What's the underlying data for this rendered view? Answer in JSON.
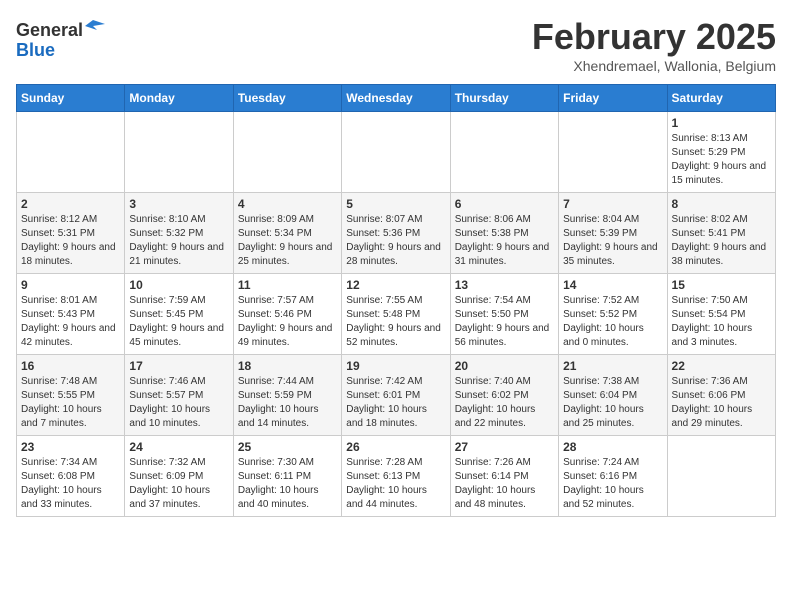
{
  "header": {
    "logo_line1": "General",
    "logo_line2": "Blue",
    "month_year": "February 2025",
    "location": "Xhendremael, Wallonia, Belgium"
  },
  "weekdays": [
    "Sunday",
    "Monday",
    "Tuesday",
    "Wednesday",
    "Thursday",
    "Friday",
    "Saturday"
  ],
  "weeks": [
    [
      {
        "day": "",
        "info": ""
      },
      {
        "day": "",
        "info": ""
      },
      {
        "day": "",
        "info": ""
      },
      {
        "day": "",
        "info": ""
      },
      {
        "day": "",
        "info": ""
      },
      {
        "day": "",
        "info": ""
      },
      {
        "day": "1",
        "info": "Sunrise: 8:13 AM\nSunset: 5:29 PM\nDaylight: 9 hours and 15 minutes."
      }
    ],
    [
      {
        "day": "2",
        "info": "Sunrise: 8:12 AM\nSunset: 5:31 PM\nDaylight: 9 hours and 18 minutes."
      },
      {
        "day": "3",
        "info": "Sunrise: 8:10 AM\nSunset: 5:32 PM\nDaylight: 9 hours and 21 minutes."
      },
      {
        "day": "4",
        "info": "Sunrise: 8:09 AM\nSunset: 5:34 PM\nDaylight: 9 hours and 25 minutes."
      },
      {
        "day": "5",
        "info": "Sunrise: 8:07 AM\nSunset: 5:36 PM\nDaylight: 9 hours and 28 minutes."
      },
      {
        "day": "6",
        "info": "Sunrise: 8:06 AM\nSunset: 5:38 PM\nDaylight: 9 hours and 31 minutes."
      },
      {
        "day": "7",
        "info": "Sunrise: 8:04 AM\nSunset: 5:39 PM\nDaylight: 9 hours and 35 minutes."
      },
      {
        "day": "8",
        "info": "Sunrise: 8:02 AM\nSunset: 5:41 PM\nDaylight: 9 hours and 38 minutes."
      }
    ],
    [
      {
        "day": "9",
        "info": "Sunrise: 8:01 AM\nSunset: 5:43 PM\nDaylight: 9 hours and 42 minutes."
      },
      {
        "day": "10",
        "info": "Sunrise: 7:59 AM\nSunset: 5:45 PM\nDaylight: 9 hours and 45 minutes."
      },
      {
        "day": "11",
        "info": "Sunrise: 7:57 AM\nSunset: 5:46 PM\nDaylight: 9 hours and 49 minutes."
      },
      {
        "day": "12",
        "info": "Sunrise: 7:55 AM\nSunset: 5:48 PM\nDaylight: 9 hours and 52 minutes."
      },
      {
        "day": "13",
        "info": "Sunrise: 7:54 AM\nSunset: 5:50 PM\nDaylight: 9 hours and 56 minutes."
      },
      {
        "day": "14",
        "info": "Sunrise: 7:52 AM\nSunset: 5:52 PM\nDaylight: 10 hours and 0 minutes."
      },
      {
        "day": "15",
        "info": "Sunrise: 7:50 AM\nSunset: 5:54 PM\nDaylight: 10 hours and 3 minutes."
      }
    ],
    [
      {
        "day": "16",
        "info": "Sunrise: 7:48 AM\nSunset: 5:55 PM\nDaylight: 10 hours and 7 minutes."
      },
      {
        "day": "17",
        "info": "Sunrise: 7:46 AM\nSunset: 5:57 PM\nDaylight: 10 hours and 10 minutes."
      },
      {
        "day": "18",
        "info": "Sunrise: 7:44 AM\nSunset: 5:59 PM\nDaylight: 10 hours and 14 minutes."
      },
      {
        "day": "19",
        "info": "Sunrise: 7:42 AM\nSunset: 6:01 PM\nDaylight: 10 hours and 18 minutes."
      },
      {
        "day": "20",
        "info": "Sunrise: 7:40 AM\nSunset: 6:02 PM\nDaylight: 10 hours and 22 minutes."
      },
      {
        "day": "21",
        "info": "Sunrise: 7:38 AM\nSunset: 6:04 PM\nDaylight: 10 hours and 25 minutes."
      },
      {
        "day": "22",
        "info": "Sunrise: 7:36 AM\nSunset: 6:06 PM\nDaylight: 10 hours and 29 minutes."
      }
    ],
    [
      {
        "day": "23",
        "info": "Sunrise: 7:34 AM\nSunset: 6:08 PM\nDaylight: 10 hours and 33 minutes."
      },
      {
        "day": "24",
        "info": "Sunrise: 7:32 AM\nSunset: 6:09 PM\nDaylight: 10 hours and 37 minutes."
      },
      {
        "day": "25",
        "info": "Sunrise: 7:30 AM\nSunset: 6:11 PM\nDaylight: 10 hours and 40 minutes."
      },
      {
        "day": "26",
        "info": "Sunrise: 7:28 AM\nSunset: 6:13 PM\nDaylight: 10 hours and 44 minutes."
      },
      {
        "day": "27",
        "info": "Sunrise: 7:26 AM\nSunset: 6:14 PM\nDaylight: 10 hours and 48 minutes."
      },
      {
        "day": "28",
        "info": "Sunrise: 7:24 AM\nSunset: 6:16 PM\nDaylight: 10 hours and 52 minutes."
      },
      {
        "day": "",
        "info": ""
      }
    ]
  ]
}
